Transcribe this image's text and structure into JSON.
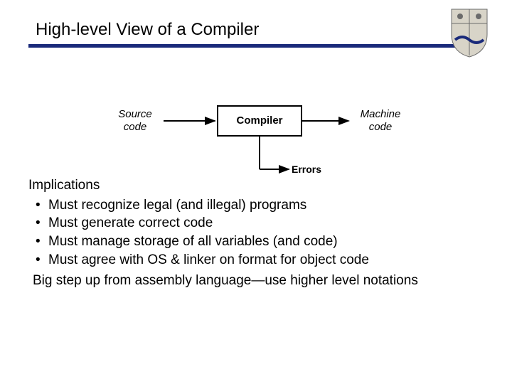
{
  "title": "High-level View of a Compiler",
  "diagram": {
    "source": "Source\ncode",
    "compiler": "Compiler",
    "machine": "Machine\ncode",
    "errors": "Errors"
  },
  "body": {
    "section_head": "Implications",
    "bullets": [
      "Must recognize legal (and illegal) programs",
      "Must generate correct code",
      "Must manage storage of all variables (and code)",
      "Must agree with OS & linker on format for object code"
    ],
    "closing": "Big step up from assembly language—use higher level notations"
  }
}
